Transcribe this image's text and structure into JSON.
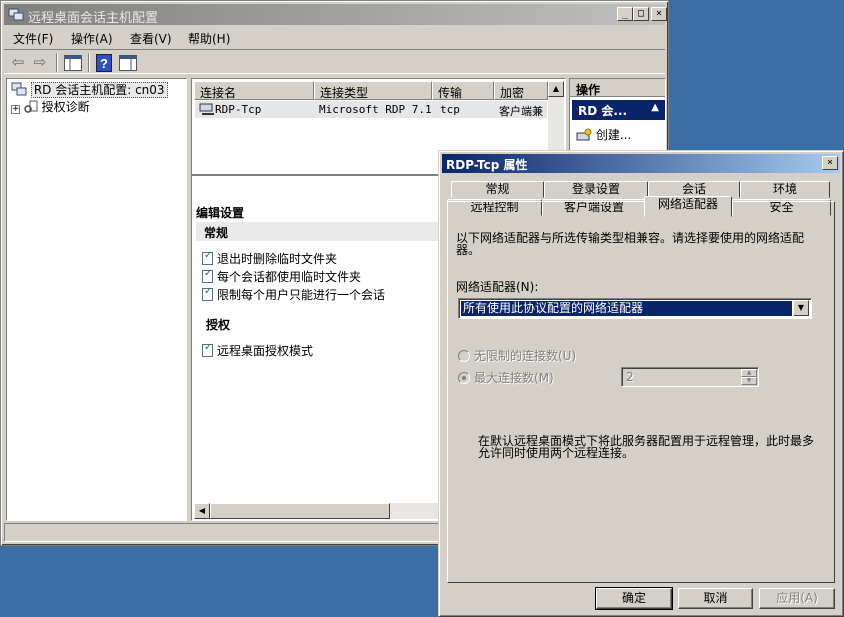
{
  "colors": {
    "desktop": "#3a6ea5",
    "active_title": "#0a246a",
    "inactive_title": "#808080",
    "face": "#d4d0c8"
  },
  "main_window": {
    "title": "远程桌面会话主机配置",
    "caption_buttons": [
      "_",
      "□",
      "×"
    ],
    "menu": [
      "文件(F)",
      "操作(A)",
      "查看(V)",
      "帮助(H)"
    ],
    "toolbar_icons": [
      "back-arrow-icon",
      "forward-arrow-icon",
      "console-tree-icon",
      "help-icon",
      "action-pane-icon"
    ],
    "tree": {
      "root": "RD 会话主机配置: cn03",
      "child": "授权诊断",
      "expander": "+"
    },
    "connections": {
      "columns": [
        "连接名",
        "连接类型",
        "传输",
        "加密"
      ],
      "rows": [
        {
          "name": "RDP-Tcp",
          "type": "Microsoft RDP 7.1",
          "transport": "tcp",
          "encryption": "客户端兼"
        }
      ]
    },
    "edit_settings": {
      "title": "编辑设置",
      "groups": [
        {
          "name": "常规",
          "items": [
            "退出时删除临时文件夹",
            "每个会话都使用临时文件夹",
            "限制每个用户只能进行一个会话"
          ]
        },
        {
          "name": "授权",
          "items": [
            "远程桌面授权模式"
          ]
        }
      ]
    },
    "actions": {
      "title": "操作",
      "section": "RD 会...",
      "items": [
        "创建..."
      ]
    }
  },
  "dialog": {
    "title": "RDP-Tcp 属性",
    "close": "×",
    "tabs_row_back": [
      "常规",
      "登录设置",
      "会话",
      "环境"
    ],
    "tabs_row_front": [
      "远程控制",
      "客户端设置",
      "网络适配器",
      "安全"
    ],
    "active_tab": "网络适配器",
    "description": "以下网络适配器与所选传输类型相兼容。请选择要使用的网络适配器。",
    "adapter_label": "网络适配器(N):",
    "adapter_selected": "所有使用此协议配置的网络适配器",
    "radio_unlimited": "无限制的连接数(U)",
    "radio_max": "最大连接数(M)",
    "max_value": "2",
    "note": "在默认远程桌面模式下将此服务器配置用于远程管理，此时最多允许同时使用两个远程连接。",
    "buttons": {
      "ok": "确定",
      "cancel": "取消",
      "apply": "应用(A)"
    }
  }
}
